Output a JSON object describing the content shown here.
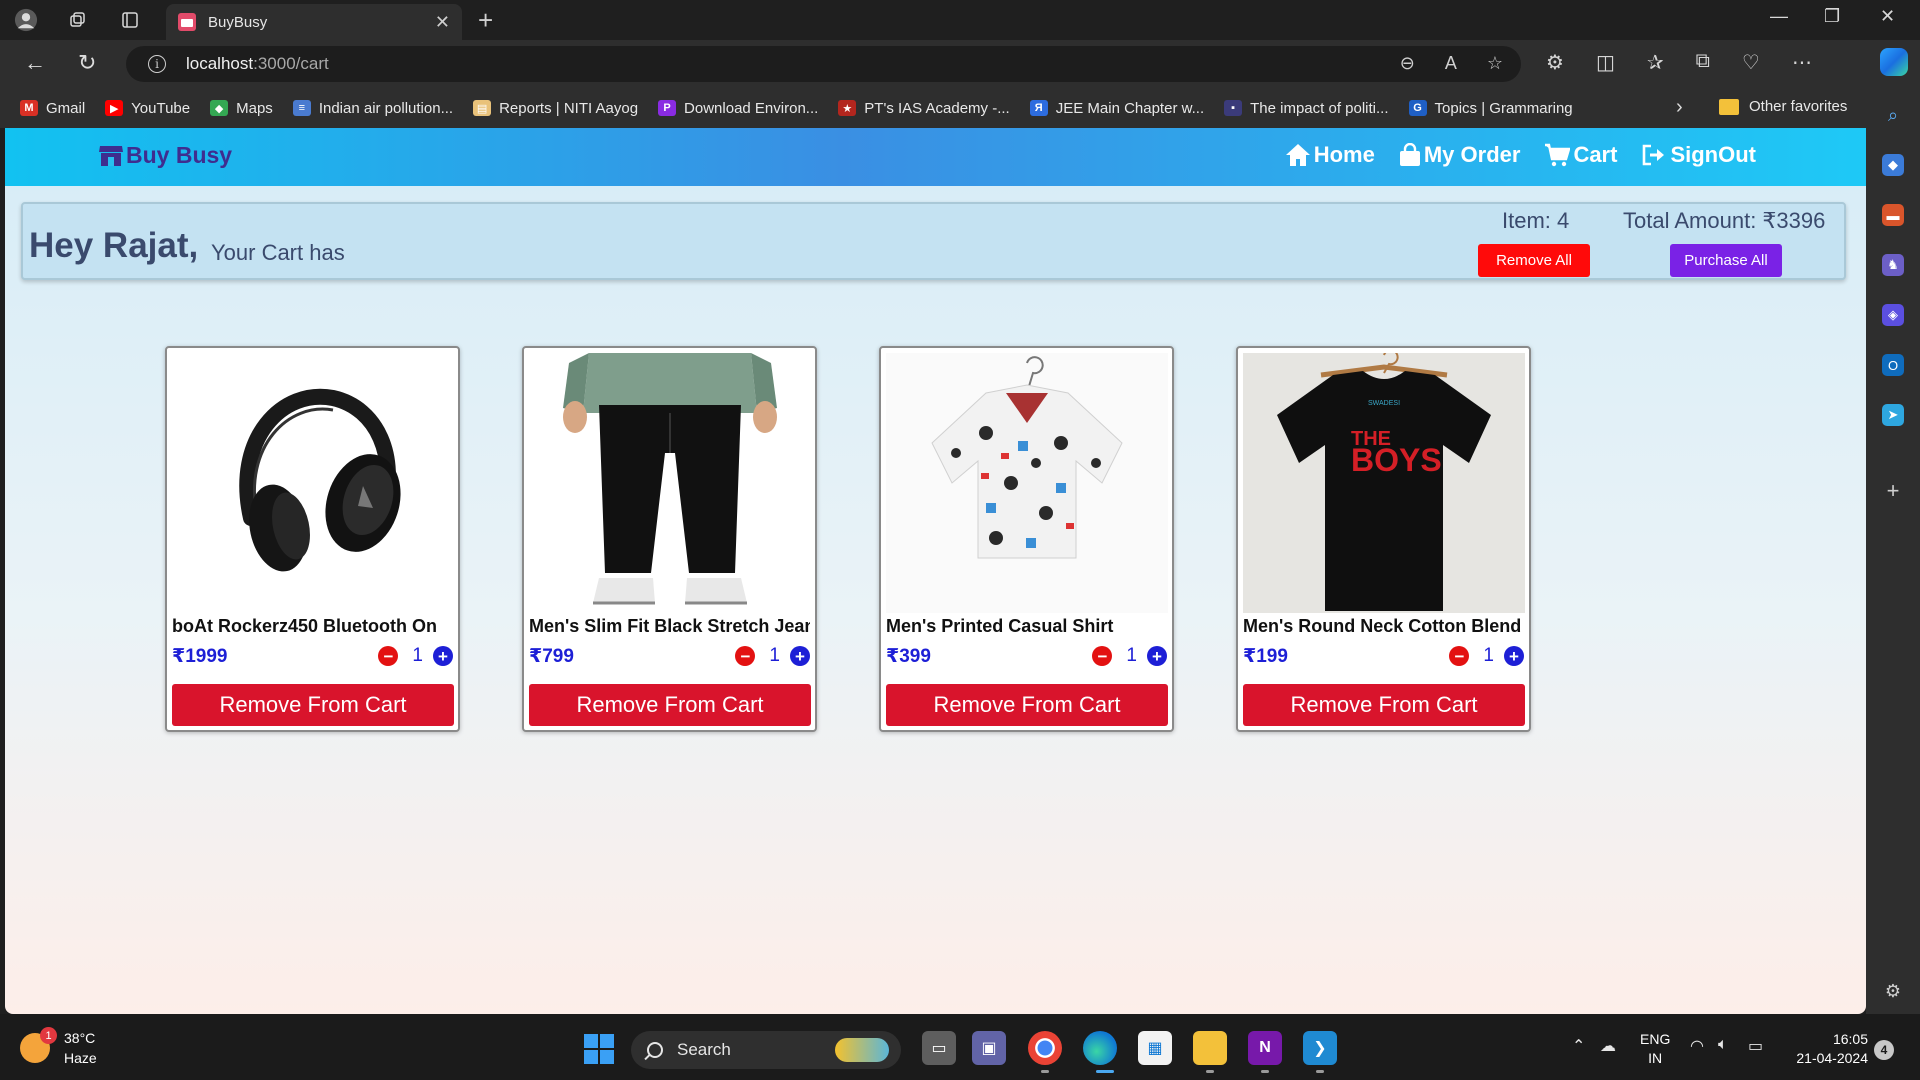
{
  "browser": {
    "tab_title": "BuyBusy",
    "url_host": "localhost",
    "url_path": ":3000/cart",
    "bookmarks": [
      {
        "label": "Gmail",
        "icon": "gmail-icon",
        "color": "#d93025"
      },
      {
        "label": "YouTube",
        "icon": "youtube-icon",
        "color": "#ff0000"
      },
      {
        "label": "Maps",
        "icon": "maps-icon",
        "color": "#34a853"
      },
      {
        "label": "Indian air pollution...",
        "icon": "page-icon",
        "color": "#4a7bd0"
      },
      {
        "label": "Reports | NITI Aayog",
        "icon": "niti-icon",
        "color": "#e9c27a"
      },
      {
        "label": "Download Environ...",
        "icon": "p-icon",
        "color": "#8a2be2"
      },
      {
        "label": "PT's IAS Academy -...",
        "icon": "pt-icon",
        "color": "#b3261e"
      },
      {
        "label": "JEE Main Chapter w...",
        "icon": "jee-icon",
        "color": "#2d6cdf"
      },
      {
        "label": "The impact of politi...",
        "icon": "doc-icon",
        "color": "#3b3b7a"
      },
      {
        "label": "Topics | Grammaring",
        "icon": "g-icon",
        "color": "#1f5fc4"
      }
    ],
    "other_favorites": "Other favorites"
  },
  "app": {
    "brand": "Buy Busy",
    "nav": {
      "home": "Home",
      "my_order": "My Order",
      "cart": "Cart",
      "signout": "SignOut"
    }
  },
  "summary": {
    "greeting": "Hey Rajat,",
    "subtitle": "Your Cart has",
    "items": "Item: 4",
    "total": "Total Amount: ₹3396",
    "remove_all": "Remove All",
    "purchase_all": "Purchase All"
  },
  "cart_items": [
    {
      "name": "boAt Rockerz450 Bluetooth On",
      "price": "₹1999",
      "qty": "1",
      "remove_label": "Remove From Cart",
      "image": "headphones"
    },
    {
      "name": "Men's Slim Fit Black Stretch Jeans",
      "price": "₹799",
      "qty": "1",
      "remove_label": "Remove From Cart",
      "image": "jeans"
    },
    {
      "name": "Men's Printed Casual Shirt",
      "price": "₹399",
      "qty": "1",
      "remove_label": "Remove From Cart",
      "image": "shirt"
    },
    {
      "name": "Men's Round Neck Cotton Blend",
      "price": "₹199",
      "qty": "1",
      "remove_label": "Remove From Cart",
      "image": "tshirt"
    }
  ],
  "tshirt_print": {
    "top": "SWADESI",
    "line1": "THE",
    "line2": "BOYS"
  },
  "taskbar": {
    "temperature": "38°C",
    "weather": "Haze",
    "weather_badge": "1",
    "search": "Search",
    "lang_top": "ENG",
    "lang_bottom": "IN",
    "time": "16:05",
    "date": "21-04-2024",
    "notifications": "4"
  },
  "colors": {
    "nav_gradient_start": "#12c2f1",
    "brand": "#3f2d8f",
    "remove_all": "#ff0a0a",
    "purchase_all": "#7a22e6",
    "remove_from_cart": "#d9142c",
    "price": "#1d1fd6"
  }
}
